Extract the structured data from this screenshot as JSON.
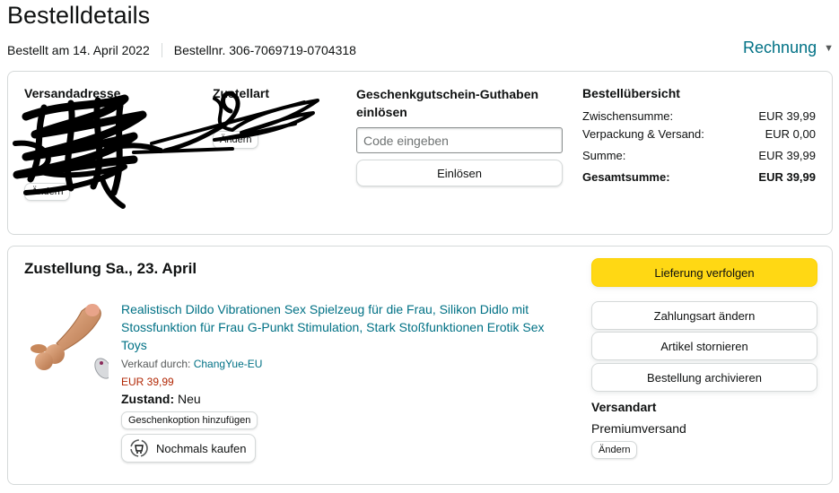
{
  "header": {
    "title": "Bestelldetails",
    "ordered_on": "Bestellt am 14. April 2022",
    "order_number": "Bestellnr. 306-7069719-0704318",
    "invoice_label": "Rechnung",
    "invoice_icon": "chevron-down-icon"
  },
  "address_section": {
    "heading": "Versandadresse",
    "change_label": "Ändern",
    "shipping_heading_partial": "Zustellart",
    "change_label_2": "Ändern"
  },
  "gift_card": {
    "title": "Geschenkgutschein-Guthaben einlösen",
    "input_placeholder": "Code eingeben",
    "input_value": "",
    "redeem_label": "Einlösen"
  },
  "summary": {
    "title": "Bestellübersicht",
    "rows": [
      {
        "label": "Zwischensumme:",
        "value": "EUR 39,99"
      },
      {
        "label": "Verpackung & Versand:",
        "value": "EUR 0,00"
      },
      {
        "label": "Summe:",
        "value": "EUR 39,99"
      }
    ],
    "total": {
      "label": "Gesamtsumme:",
      "value": "EUR 39,99"
    }
  },
  "shipment": {
    "delivery_title": "Zustellung Sa., 23. April",
    "product": {
      "title": "Realistisch Dildo Vibrationen Sex Spielzeug für die Frau, Silikon Didlo mit Stossfunktion für Frau G-Punkt Stimulation, Stark Stoßfunktionen Erotik Sex Toys",
      "seller_label": "Verkauf durch: ",
      "seller_name": "ChangYue-EU",
      "price": "EUR 39,99",
      "condition_label": "Zustand:",
      "condition_value": " Neu",
      "gift_option_label": "Geschenkoption hinzufügen",
      "buy_again_label": "Nochmals kaufen",
      "buy_again_icon": "reorder-icon"
    },
    "actions": {
      "track": "Lieferung verfolgen",
      "change_payment": "Zahlungsart ändern",
      "cancel_items": "Artikel stornieren",
      "archive_order": "Bestellung archivieren"
    },
    "shipping": {
      "heading": "Versandart",
      "value": "Premiumversand",
      "change_label": "Ändern"
    }
  },
  "colors": {
    "link": "#007185",
    "price": "#b12704",
    "primary_button": "#ffd814",
    "border": "#d5d9d9",
    "redaction": "#000000"
  }
}
